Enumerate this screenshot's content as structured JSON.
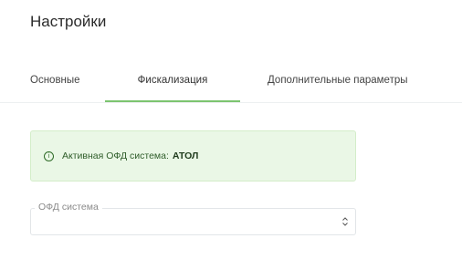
{
  "page": {
    "title": "Настройки"
  },
  "tabs": [
    {
      "label": "Основные",
      "active": false
    },
    {
      "label": "Фискализация",
      "active": true
    },
    {
      "label": "Дополнительные параметры",
      "active": false
    }
  ],
  "alert": {
    "icon": "info-circle-icon",
    "label": "Активная ОФД система:",
    "value": "АТОЛ",
    "background": "#eaf7e6"
  },
  "ofd_select": {
    "label": "ОФД система",
    "value": "",
    "icon": "chevron-up-down-icon"
  },
  "colors": {
    "accent": "#7cc46f"
  }
}
